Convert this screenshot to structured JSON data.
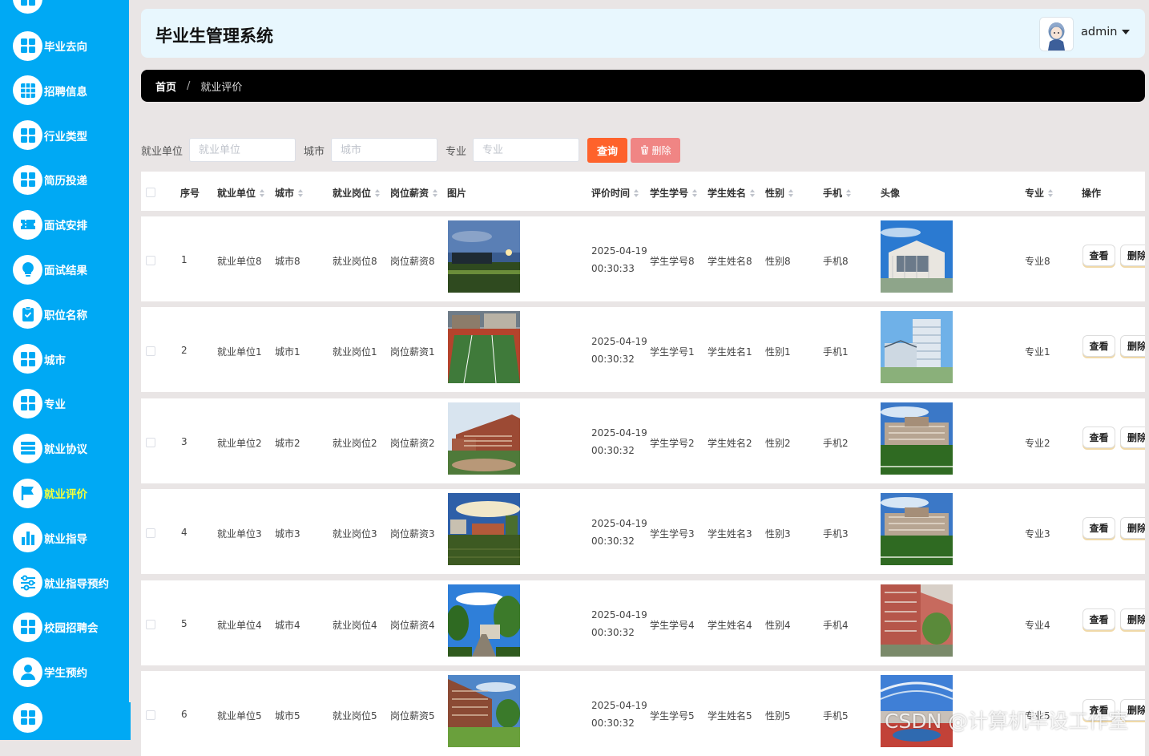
{
  "colors": {
    "sidebar": "#00a9f4",
    "active_label": "#f5ff3b",
    "search_button": "#fe622b",
    "delete_button": "#f08584",
    "header_bg": "#e8f7fe",
    "breadcrumb_bg": "#000000"
  },
  "sidebar": {
    "items": [
      {
        "label": "毕业去向",
        "icon": "grid-icon"
      },
      {
        "label": "招聘信息",
        "icon": "table-grid-icon"
      },
      {
        "label": "行业类型",
        "icon": "grid-icon"
      },
      {
        "label": "简历投递",
        "icon": "grid-icon"
      },
      {
        "label": "面试安排",
        "icon": "ticket-icon"
      },
      {
        "label": "面试结果",
        "icon": "bulb-icon"
      },
      {
        "label": "职位名称",
        "icon": "clipboard-check-icon"
      },
      {
        "label": "城市",
        "icon": "grid-icon"
      },
      {
        "label": "专业",
        "icon": "grid-icon"
      },
      {
        "label": "就业协议",
        "icon": "list-icon"
      },
      {
        "label": "就业评价",
        "icon": "flag-icon",
        "active": true
      },
      {
        "label": "就业指导",
        "icon": "bar-chart-icon"
      },
      {
        "label": "就业指导预约",
        "icon": "sliders-icon"
      },
      {
        "label": "校园招聘会",
        "icon": "grid-icon"
      },
      {
        "label": "学生预约",
        "icon": "user-icon"
      }
    ]
  },
  "header": {
    "title": "毕业生管理系统",
    "user": "admin"
  },
  "breadcrumb": {
    "home": "首页",
    "separator": "/",
    "current": "就业评价"
  },
  "filters": {
    "unit_label": "就业单位",
    "unit_placeholder": "就业单位",
    "city_label": "城市",
    "city_placeholder": "城市",
    "major_label": "专业",
    "major_placeholder": "专业",
    "search_label": "查询",
    "delete_label": "删除"
  },
  "table": {
    "columns": {
      "index": "序号",
      "unit": "就业单位",
      "city": "城市",
      "post": "就业岗位",
      "salary": "岗位薪资",
      "image": "图片",
      "time": "评价时间",
      "student_no": "学生学号",
      "student_name": "学生姓名",
      "gender": "性别",
      "phone": "手机",
      "avatar": "头像",
      "major": "专业",
      "actions": "操作"
    },
    "view_label": "查看",
    "delete_label": "删除",
    "rows": [
      {
        "index": "1",
        "unit": "就业单位8",
        "city": "城市8",
        "post": "就业岗位8",
        "salary": "岗位薪资8",
        "date": "2025-04-19",
        "time": "00:30:33",
        "student_no": "学生学号8",
        "student_name": "学生姓名8",
        "gender": "性别8",
        "phone": "手机8",
        "major": "专业8",
        "image": "campus-dusk-photo",
        "avatar": "building-photo"
      },
      {
        "index": "2",
        "unit": "就业单位1",
        "city": "城市1",
        "post": "就业岗位1",
        "salary": "岗位薪资1",
        "date": "2025-04-19",
        "time": "00:30:32",
        "student_no": "学生学号1",
        "student_name": "学生姓名1",
        "gender": "性别1",
        "phone": "手机1",
        "major": "专业1",
        "image": "sports-field-photo",
        "avatar": "office-building-photo"
      },
      {
        "index": "3",
        "unit": "就业单位2",
        "city": "城市2",
        "post": "就业岗位2",
        "salary": "岗位薪资2",
        "date": "2025-04-19",
        "time": "00:30:32",
        "student_no": "学生学号2",
        "student_name": "学生姓名2",
        "gender": "性别2",
        "phone": "手机2",
        "major": "专业2",
        "image": "brick-building-photo",
        "avatar": "campus-lawn-photo"
      },
      {
        "index": "4",
        "unit": "就业单位3",
        "city": "城市3",
        "post": "就业岗位3",
        "salary": "岗位薪资3",
        "date": "2025-04-19",
        "time": "00:30:32",
        "student_no": "学生学号3",
        "student_name": "学生姓名3",
        "gender": "性别3",
        "phone": "手机3",
        "major": "专业3",
        "image": "field-sunset-photo",
        "avatar": "campus-lawn-photo"
      },
      {
        "index": "5",
        "unit": "就业单位4",
        "city": "城市4",
        "post": "就业岗位4",
        "salary": "岗位薪资4",
        "date": "2025-04-19",
        "time": "00:30:32",
        "student_no": "学生学号4",
        "student_name": "学生姓名4",
        "gender": "性别4",
        "phone": "手机4",
        "major": "专业4",
        "image": "tree-road-photo",
        "avatar": "red-building-photo"
      },
      {
        "index": "6",
        "unit": "就业单位5",
        "city": "城市5",
        "post": "就业岗位5",
        "salary": "岗位薪资5",
        "date": "2025-04-19",
        "time": "00:30:32",
        "student_no": "学生学号5",
        "student_name": "学生姓名5",
        "gender": "性别5",
        "phone": "手机5",
        "major": "专业5",
        "image": "dorm-lawn-photo",
        "avatar": "stadium-photo"
      }
    ]
  },
  "watermark": "CSDN @计算机毕设工作室"
}
